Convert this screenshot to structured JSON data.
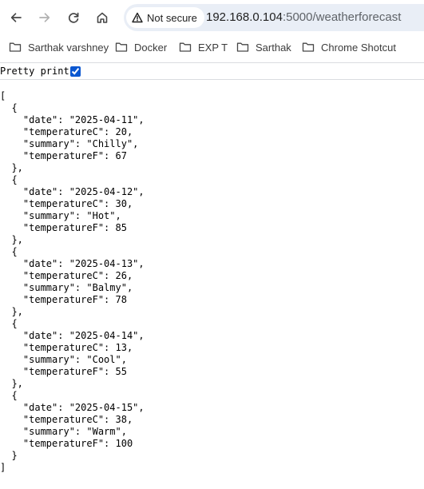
{
  "toolbar": {
    "security_label": "Not secure",
    "url_host": "192.168.0.104",
    "url_rest": ":5000/weatherforecast"
  },
  "bookmarks": [
    "Sarthak varshney",
    "Docker",
    "EXP T",
    "Sarthak",
    "Chrome Shotcut"
  ],
  "pretty_print": {
    "label": "Pretty print",
    "checked": true
  },
  "json_body": "[\n  {\n    \"date\": \"2025-04-11\",\n    \"temperatureC\": 20,\n    \"summary\": \"Chilly\",\n    \"temperatureF\": 67\n  },\n  {\n    \"date\": \"2025-04-12\",\n    \"temperatureC\": 30,\n    \"summary\": \"Hot\",\n    \"temperatureF\": 85\n  },\n  {\n    \"date\": \"2025-04-13\",\n    \"temperatureC\": 26,\n    \"summary\": \"Balmy\",\n    \"temperatureF\": 78\n  },\n  {\n    \"date\": \"2025-04-14\",\n    \"temperatureC\": 13,\n    \"summary\": \"Cool\",\n    \"temperatureF\": 55\n  },\n  {\n    \"date\": \"2025-04-15\",\n    \"temperatureC\": 38,\n    \"summary\": \"Warm\",\n    \"temperatureF\": 100\n  }\n]"
}
